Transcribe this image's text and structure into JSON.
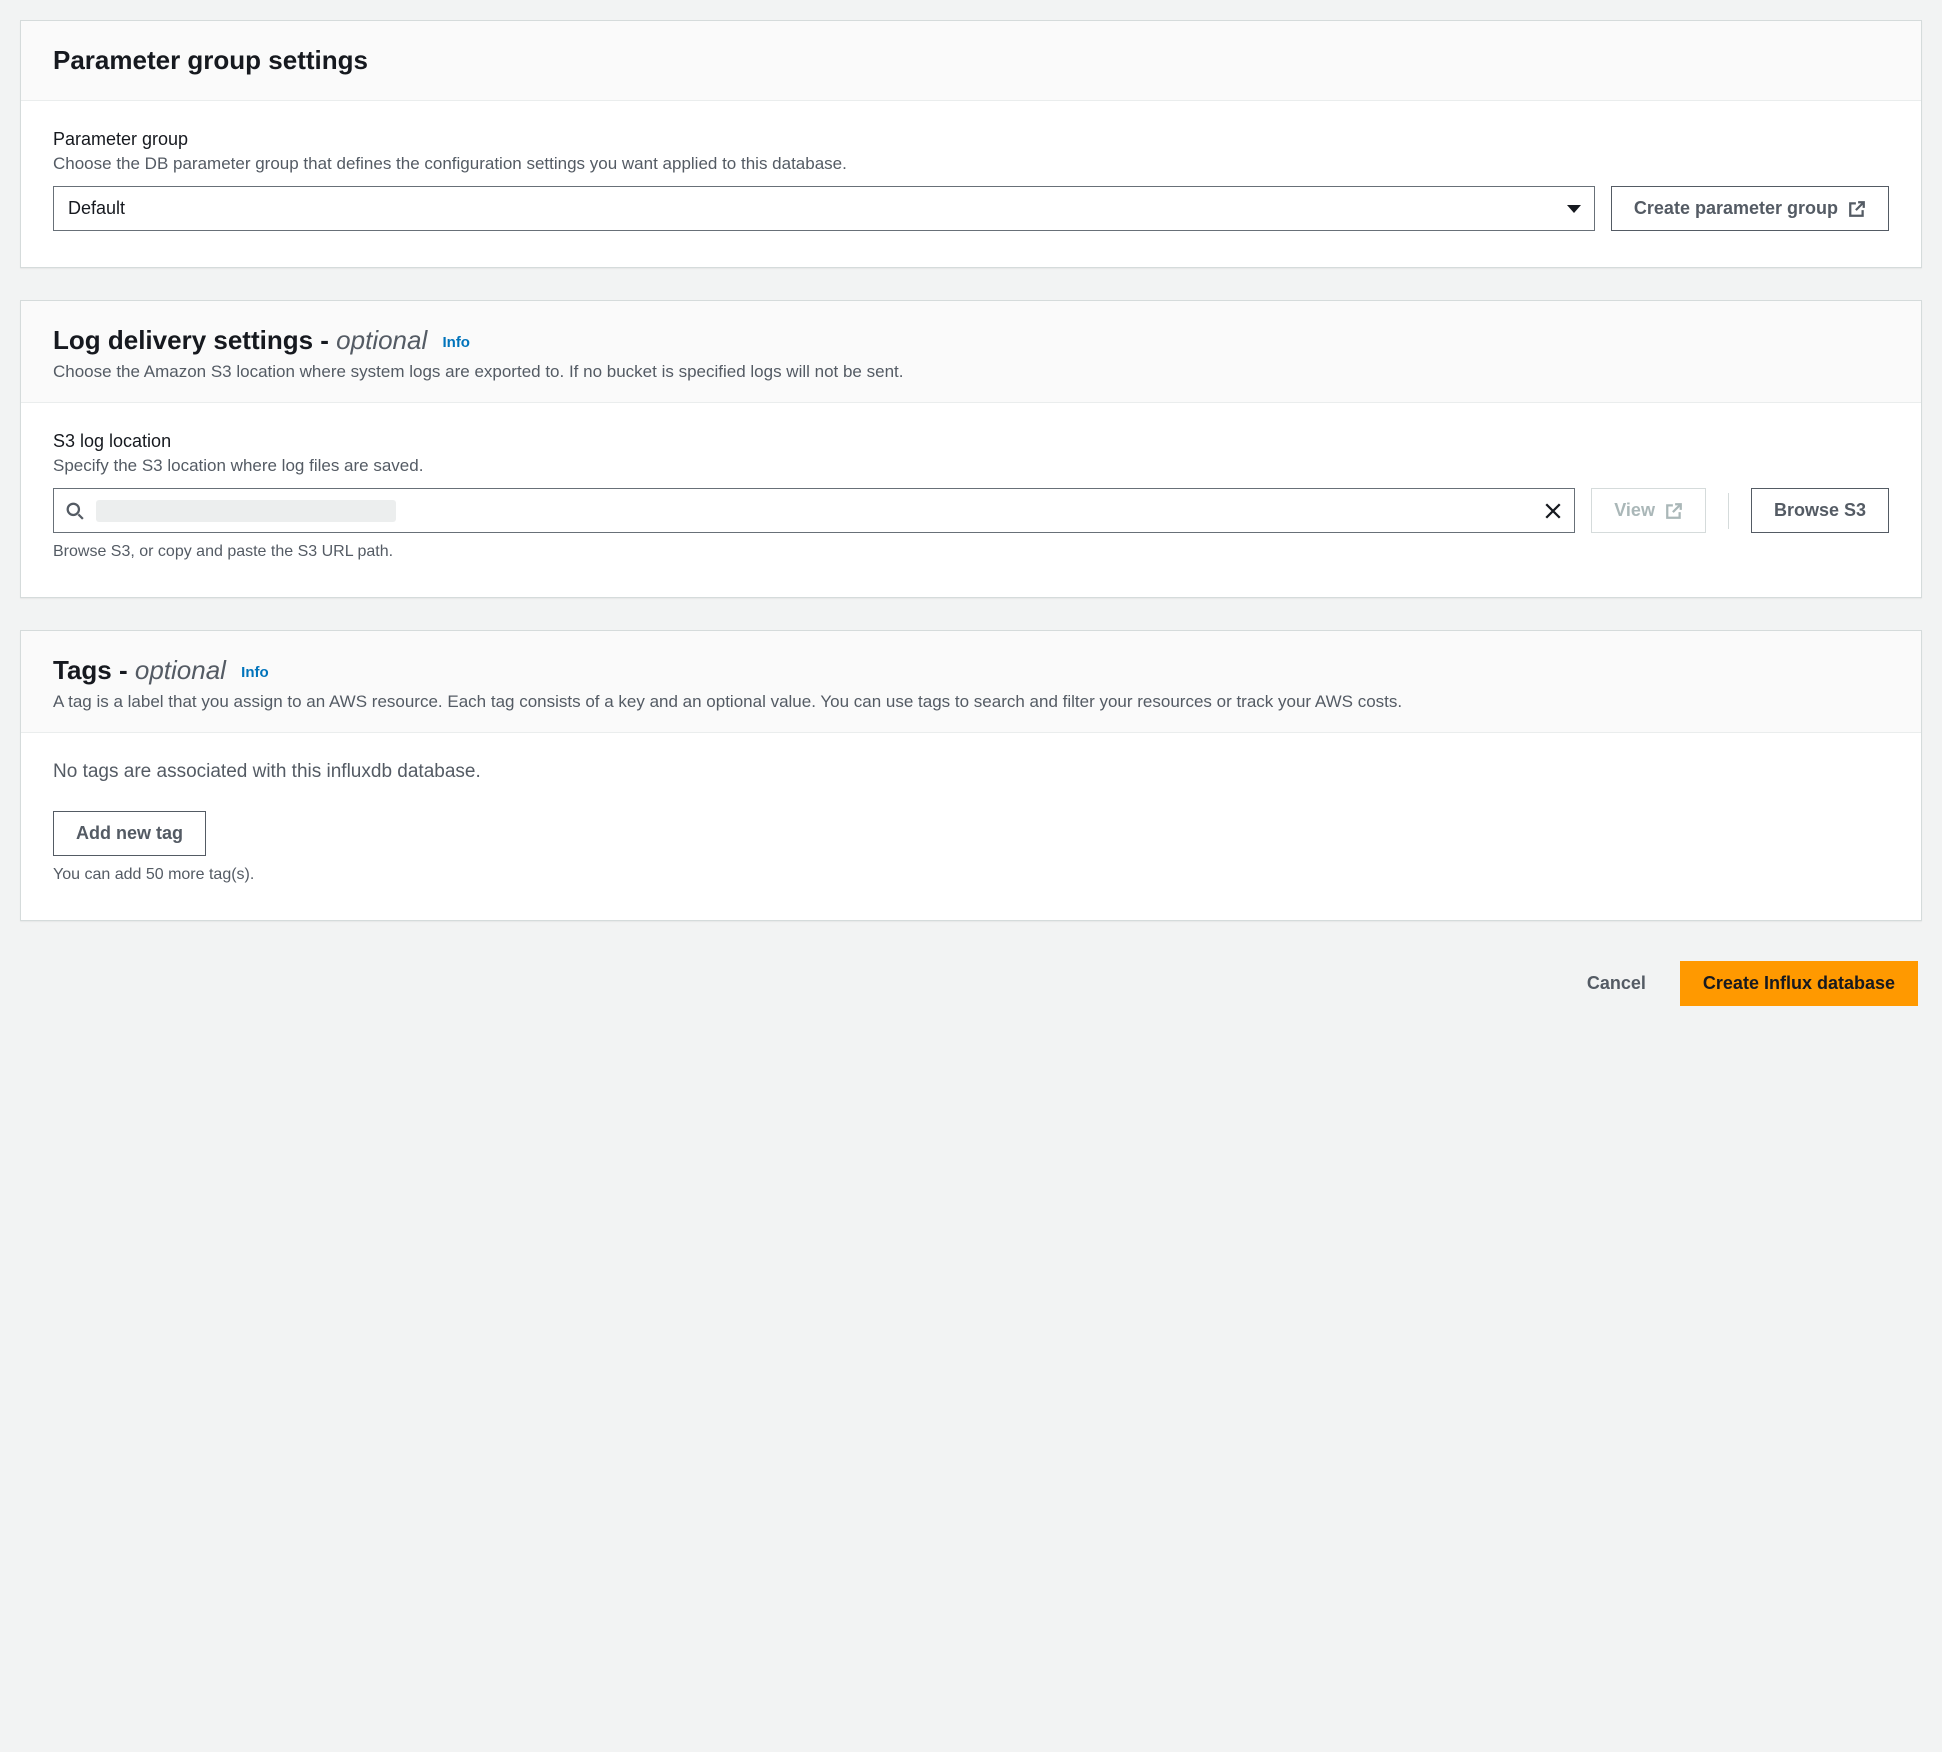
{
  "parameter_group": {
    "title": "Parameter group settings",
    "field_label": "Parameter group",
    "field_desc": "Choose the DB parameter group that defines the configuration settings you want applied to this database.",
    "selected": "Default",
    "create_button": "Create parameter group"
  },
  "log_delivery": {
    "title_main": "Log delivery settings - ",
    "title_optional": "optional",
    "info": "Info",
    "desc": "Choose the Amazon S3 location where system logs are exported to. If no bucket is specified logs will not be sent.",
    "field_label": "S3 log location",
    "field_desc": "Specify the S3 location where log files are saved.",
    "field_hint": "Browse S3, or copy and paste the S3 URL path.",
    "view_button": "View",
    "browse_button": "Browse S3"
  },
  "tags": {
    "title_main": "Tags - ",
    "title_optional": "optional",
    "info": "Info",
    "desc": "A tag is a label that you assign to an AWS resource. Each tag consists of a key and an optional value. You can use tags to search and filter your resources or track your AWS costs.",
    "empty_msg": "No tags are associated with this influxdb database.",
    "add_button": "Add new tag",
    "limit_msg": "You can add 50 more tag(s)."
  },
  "footer": {
    "cancel": "Cancel",
    "create": "Create Influx database"
  }
}
